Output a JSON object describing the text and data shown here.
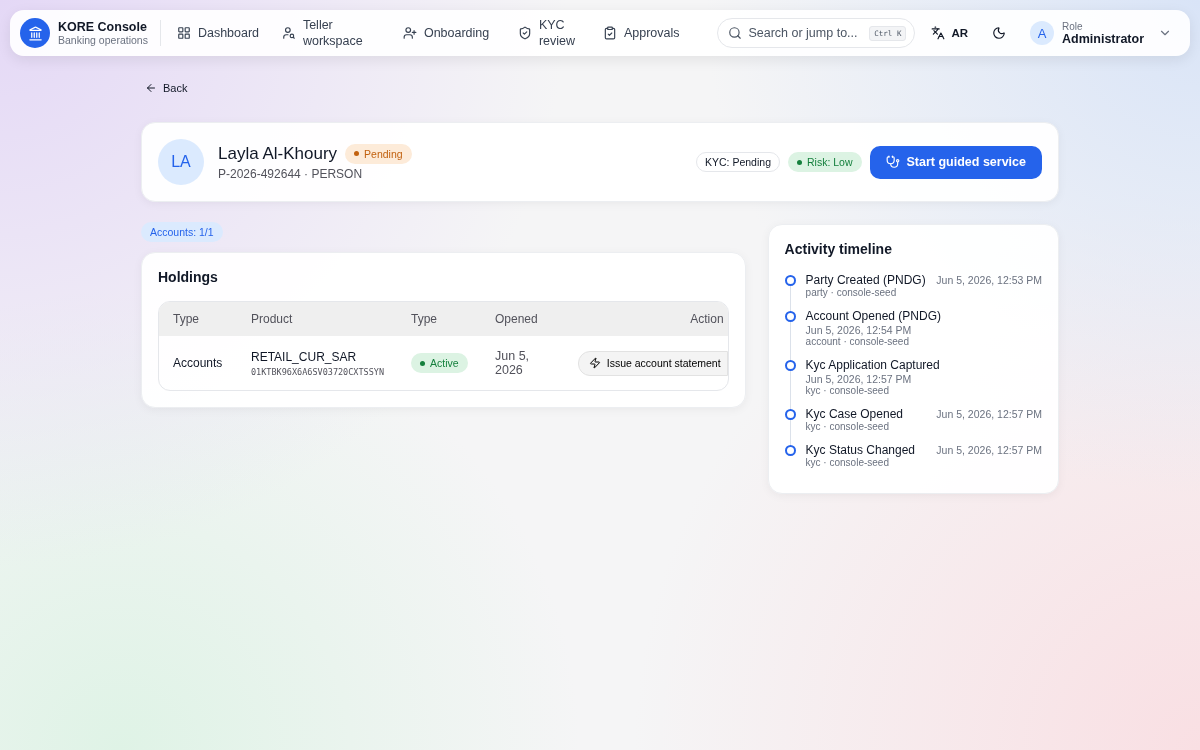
{
  "brand": {
    "title": "KORE Console",
    "subtitle": "Banking operations"
  },
  "nav": [
    {
      "label": "Dashboard"
    },
    {
      "label": "Teller workspace"
    },
    {
      "label": "Onboarding"
    },
    {
      "label": "KYC review"
    },
    {
      "label": "Approvals"
    }
  ],
  "search": {
    "placeholder": "Search or jump to...",
    "shortcut": "Ctrl K"
  },
  "language": "AR",
  "user": {
    "initial": "A",
    "role_label": "Role",
    "role": "Administrator"
  },
  "back": "Back",
  "party": {
    "initials": "LA",
    "name": "Layla Al-Khoury",
    "status": "Pending",
    "id_line": "P-2026-492644 · PERSON",
    "kyc": "KYC: Pending",
    "risk": "Risk: Low",
    "action": "Start guided service"
  },
  "accounts_badge": "Accounts: 1/1",
  "holdings": {
    "title": "Holdings",
    "columns": [
      "Type",
      "Product",
      "Type",
      "Opened",
      "Action"
    ],
    "rows": [
      {
        "type": "Accounts",
        "product": "RETAIL_CUR_SAR",
        "product_id": "01KTBK96X6A6SV03720CXTSSYN",
        "status": "Active",
        "opened": "Jun 5, 2026",
        "action": "Issue account statement"
      }
    ]
  },
  "timeline": {
    "title": "Activity timeline",
    "items": [
      {
        "title": "Party Created (PNDG)",
        "time": "Jun 5, 2026, 12:53 PM",
        "meta": "party · console-seed"
      },
      {
        "title": "Account Opened (PNDG)",
        "time": "Jun 5, 2026, 12:54 PM",
        "meta": "account · console-seed"
      },
      {
        "title": "Kyc Application Captured",
        "time": "Jun 5, 2026, 12:57 PM",
        "meta": "kyc · console-seed"
      },
      {
        "title": "Kyc Case Opened",
        "time": "Jun 5, 2026, 12:57 PM",
        "meta": "kyc · console-seed"
      },
      {
        "title": "Kyc Status Changed",
        "time": "Jun 5, 2026, 12:57 PM",
        "meta": "kyc · console-seed"
      }
    ]
  }
}
